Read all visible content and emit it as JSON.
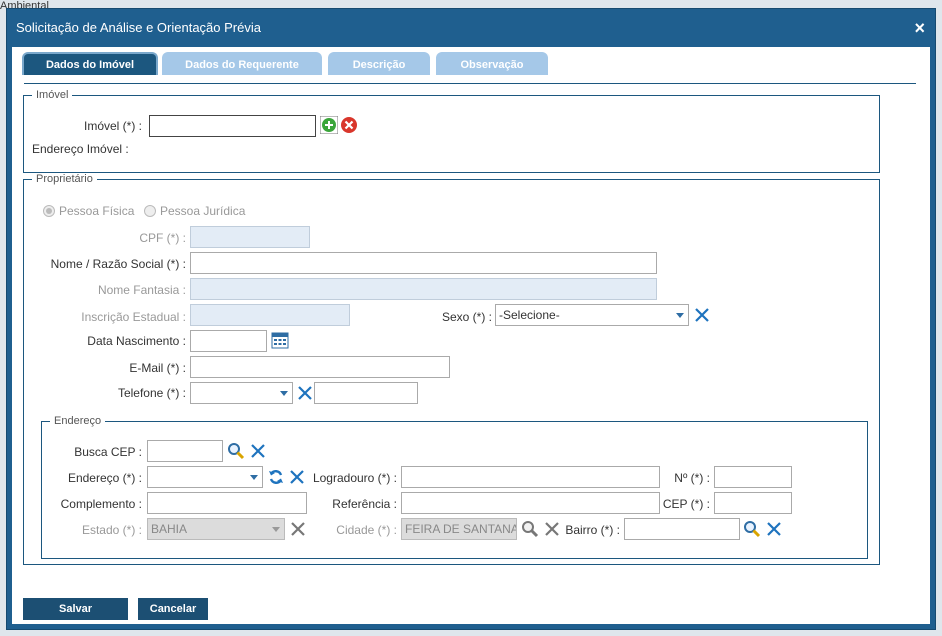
{
  "background": {
    "text_ambiental": "Ambiental"
  },
  "dialog": {
    "title": "Solicitação de Análise e Orientação Prévia",
    "close_glyph": "×"
  },
  "tabs": [
    {
      "label": "Dados do Imóvel"
    },
    {
      "label": "Dados do Requerente"
    },
    {
      "label": "Descrição"
    },
    {
      "label": "Observação"
    }
  ],
  "imovel": {
    "legend": "Imóvel",
    "imovel_label": "Imóvel (*) :",
    "imovel_value": "",
    "endereco_label": "Endereço Imóvel :"
  },
  "proprietario": {
    "legend": "Proprietário",
    "radio_fisica": "Pessoa Física",
    "radio_juridica": "Pessoa Jurídica",
    "cpf_label": "CPF (*) :",
    "nome_label": "Nome / Razão Social (*) :",
    "fantasia_label": "Nome Fantasia :",
    "inscricao_label": "Inscrição Estadual :",
    "sexo_label": "Sexo (*) :",
    "sexo_value": "-Selecione-",
    "nascimento_label": "Data Nascimento :",
    "email_label": "E-Mail (*) :",
    "telefone_label": "Telefone (*) :"
  },
  "endereco": {
    "legend": "Endereço",
    "busca_cep_label": "Busca CEP :",
    "endereco_label": "Endereço (*) :",
    "logradouro_label": "Logradouro (*) :",
    "numero_label": "Nº (*) :",
    "complemento_label": "Complemento :",
    "referencia_label": "Referência :",
    "cep_label": "CEP (*) :",
    "estado_label": "Estado (*) :",
    "estado_value": "BAHIA",
    "cidade_label": "Cidade (*) :",
    "cidade_value": "FEIRA DE SANTANA",
    "bairro_label": "Bairro (*) :"
  },
  "buttons": {
    "salvar": "Salvar",
    "cancelar": "Cancelar"
  },
  "colors": {
    "accent": "#1c577f",
    "tab_inactive": "#a5c8e8",
    "clear_icon": "#1e73be"
  }
}
